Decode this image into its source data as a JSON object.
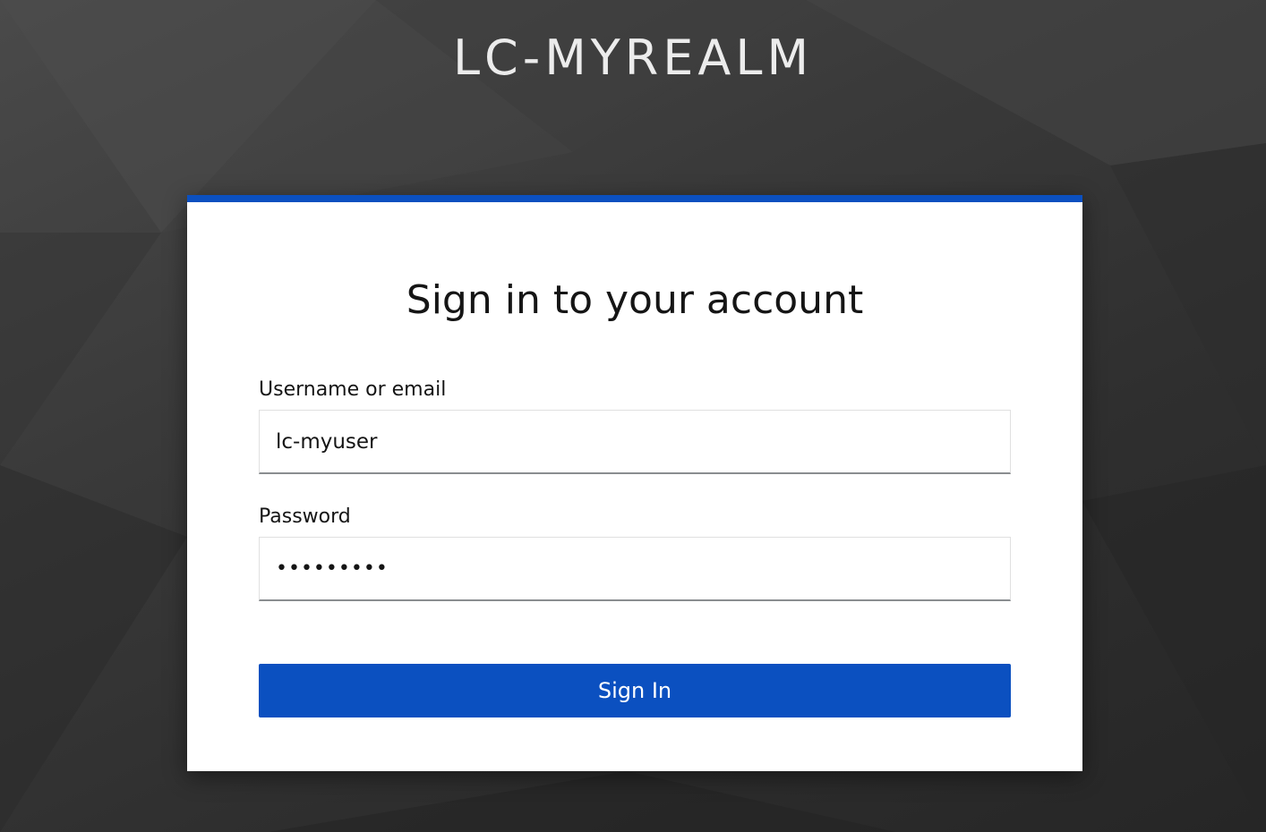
{
  "realm": {
    "title": "LC-MYREALM"
  },
  "login_card": {
    "title": "Sign in to your account",
    "username": {
      "label": "Username or email",
      "value": "lc-myuser"
    },
    "password": {
      "label": "Password",
      "value": "•••••••••"
    },
    "submit_label": "Sign In"
  },
  "colors": {
    "accent": "#0b50c0",
    "background": "#3a3a3a",
    "card_background": "#ffffff"
  }
}
